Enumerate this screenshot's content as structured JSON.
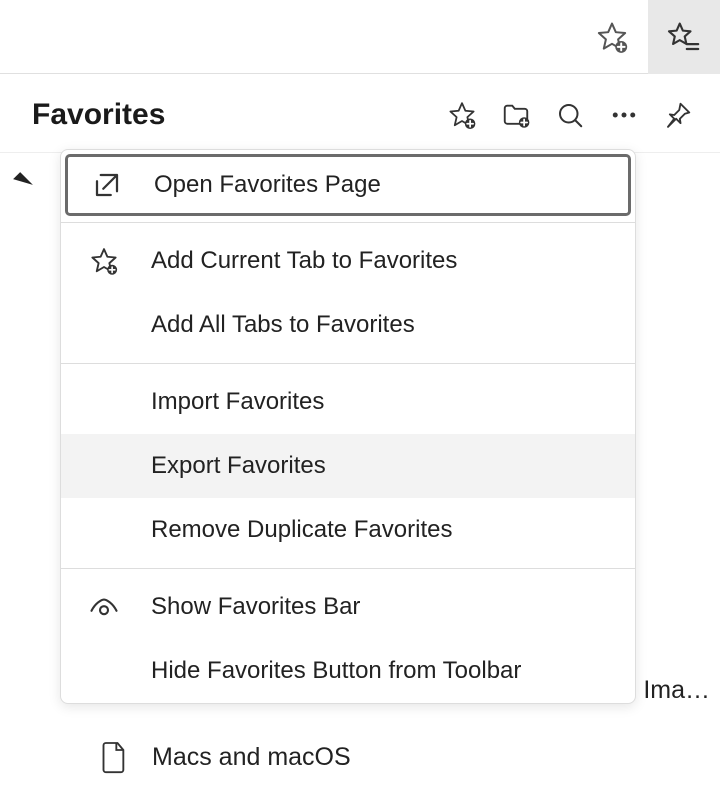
{
  "panel": {
    "title": "Favorites",
    "truncated_text": "Ima…",
    "visible_row_label": "Macs and macOS"
  },
  "menu": {
    "items": [
      {
        "label": "Open Favorites Page",
        "focused": true
      },
      {
        "label": "Add Current Tab to Favorites"
      },
      {
        "label": "Add All Tabs to Favorites"
      },
      {
        "label": "Import Favorites"
      },
      {
        "label": "Export Favorites",
        "hovered": true
      },
      {
        "label": "Remove Duplicate Favorites"
      },
      {
        "label": "Show Favorites Bar"
      },
      {
        "label": "Hide Favorites Button from Toolbar"
      }
    ]
  }
}
